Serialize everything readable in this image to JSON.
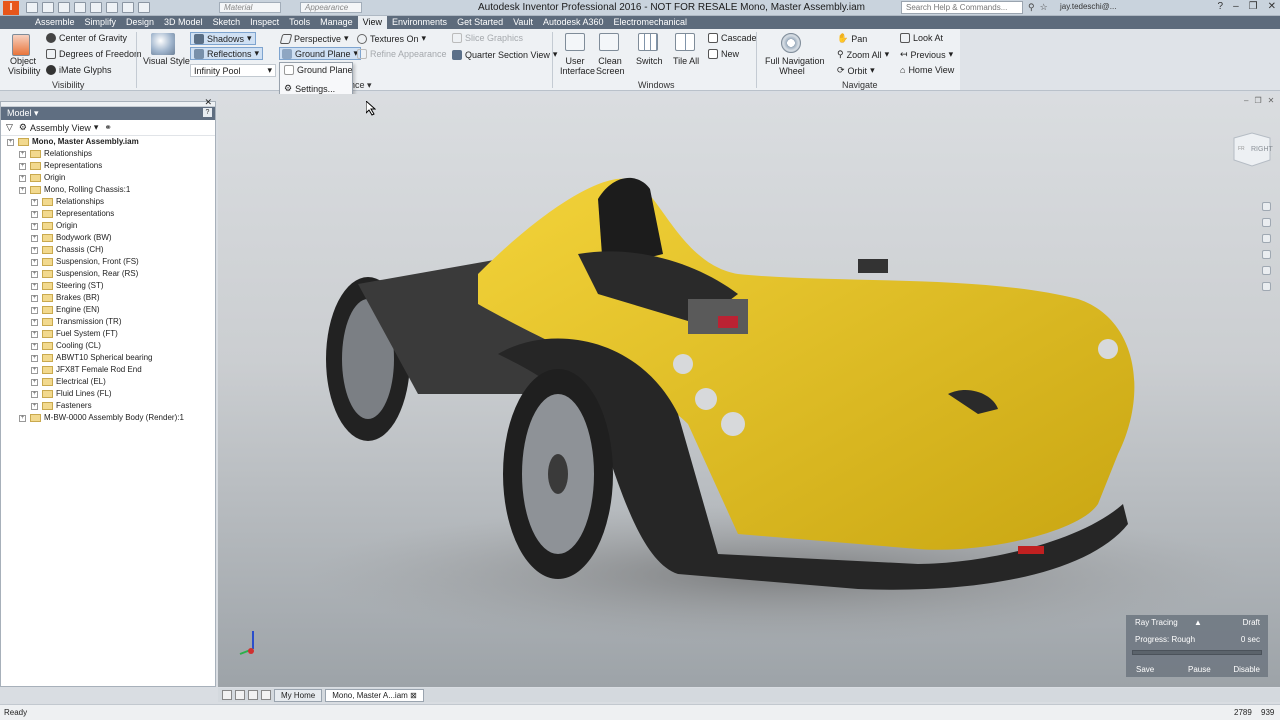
{
  "window": {
    "app_title": "Autodesk Inventor Professional 2016 - NOT FOR RESALE   Mono, Master Assembly.iam",
    "logo": "I",
    "material_placeholder": "Material",
    "appearance_placeholder": "Appearance",
    "search_placeholder": "Search Help & Commands...",
    "user": "jay.tedeschi@..."
  },
  "menu": [
    "Assemble",
    "Simplify",
    "Design",
    "3D Model",
    "Sketch",
    "Inspect",
    "Tools",
    "Manage",
    "View",
    "Environments",
    "Get Started",
    "Vault",
    "Autodesk A360",
    "Electromechanical"
  ],
  "menu_active": "View",
  "ribbon": {
    "visibility": {
      "object_visibility": "Object\nVisibility",
      "center_of_gravity": "Center of Gravity",
      "degrees_of_freedom": "Degrees of Freedom",
      "imate_glyphs": "iMate Glyphs",
      "panel": "Visibility"
    },
    "appearance": {
      "visual_style": "Visual Style",
      "shadows": "Shadows",
      "reflections": "Reflections",
      "environment": "Infinity Pool",
      "perspective": "Perspective",
      "ground_plane": "Ground Plane",
      "textures_on": "Textures On",
      "refine_appearance": "Refine Appearance",
      "slice_graphics": "Slice Graphics",
      "quarter_section": "Quarter Section View",
      "panel": "nce"
    },
    "dropdown": {
      "ground_plane": "Ground Plane",
      "settings": "Settings..."
    },
    "windows": {
      "user_interface": "User\nInterface",
      "clean_screen": "Clean\nScreen",
      "switch": "Switch",
      "tile_all": "Tile All",
      "cascade": "Cascade",
      "new": "New",
      "panel": "Windows"
    },
    "navigate": {
      "full_nav_wheel": "Full Navigation\nWheel",
      "pan": "Pan",
      "zoom_all": "Zoom All",
      "orbit": "Orbit",
      "look_at": "Look At",
      "previous": "Previous",
      "home_view": "Home View",
      "panel": "Navigate"
    }
  },
  "model_panel": {
    "title": "Model",
    "view_mode": "Assembly View",
    "tree": [
      {
        "label": "Mono, Master Assembly.iam",
        "level": 0,
        "bold": true
      },
      {
        "label": "Relationships",
        "level": 1
      },
      {
        "label": "Representations",
        "level": 1
      },
      {
        "label": "Origin",
        "level": 1
      },
      {
        "label": "Mono, Rolling Chassis:1",
        "level": 1
      },
      {
        "label": "Relationships",
        "level": 2
      },
      {
        "label": "Representations",
        "level": 2
      },
      {
        "label": "Origin",
        "level": 2
      },
      {
        "label": "Bodywork (BW)",
        "level": 2
      },
      {
        "label": "Chassis (CH)",
        "level": 2
      },
      {
        "label": "Suspension, Front (FS)",
        "level": 2
      },
      {
        "label": "Suspension, Rear (RS)",
        "level": 2
      },
      {
        "label": "Steering (ST)",
        "level": 2
      },
      {
        "label": "Brakes (BR)",
        "level": 2
      },
      {
        "label": "Engine (EN)",
        "level": 2
      },
      {
        "label": "Transmission (TR)",
        "level": 2
      },
      {
        "label": "Fuel System (FT)",
        "level": 2
      },
      {
        "label": "Cooling (CL)",
        "level": 2
      },
      {
        "label": "ABWT10 Spherical bearing",
        "level": 2
      },
      {
        "label": "JFX8T Female Rod End",
        "level": 2
      },
      {
        "label": "Electrical (EL)",
        "level": 2
      },
      {
        "label": "Fluid Lines (FL)",
        "level": 2
      },
      {
        "label": "Fasteners",
        "level": 2
      },
      {
        "label": "M-BW-0000 Assembly Body (Render):1",
        "level": 1
      }
    ]
  },
  "viewcube": {
    "face_label": "RIGHT",
    "front_label": "FR"
  },
  "ray_tracing": {
    "title": "Ray Tracing",
    "quality": "Draft",
    "progress_label": "Progress: Rough",
    "time": "0 sec",
    "progress_fraction": 0.0,
    "save": "Save",
    "pause": "Pause",
    "disable": "Disable"
  },
  "doc_tabs": [
    "My Home",
    "Mono, Master A...iam"
  ],
  "status": {
    "text": "Ready",
    "coord_a": "2789",
    "coord_b": "939"
  },
  "colors": {
    "accent": "#e8561a",
    "car_yellow": "#e3c21a",
    "menubar": "#5d6b7c"
  }
}
